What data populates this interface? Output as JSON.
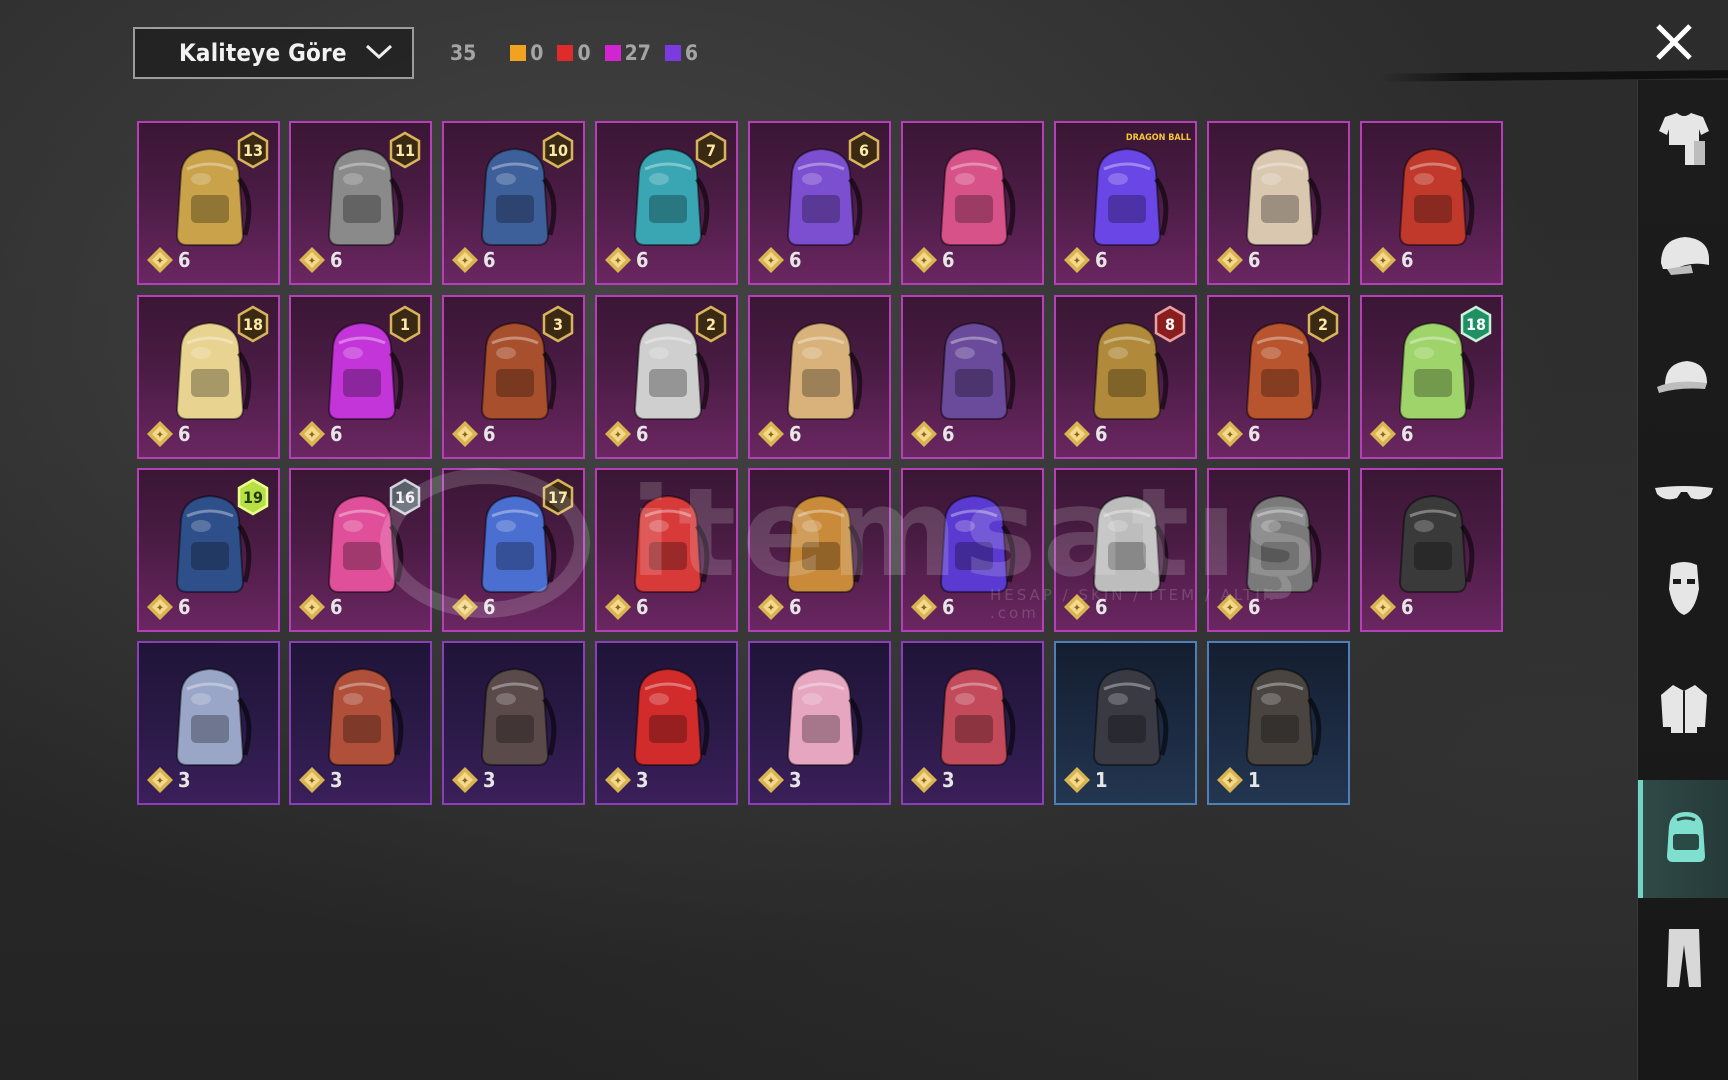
{
  "toolbar": {
    "sort_label": "Kaliteye Göre",
    "sort_icon": "chevron-down-icon",
    "total_count": "35",
    "quality_counts": [
      {
        "color": "#f1a220",
        "count": "0"
      },
      {
        "color": "#e02b2b",
        "count": "0"
      },
      {
        "color": "#d025d0",
        "count": "27"
      },
      {
        "color": "#7b3be0",
        "count": "6"
      }
    ],
    "close_icon": "close-icon"
  },
  "sidebar": {
    "items": [
      {
        "icon": "outfit-icon",
        "active": false
      },
      {
        "icon": "helmet-icon",
        "active": false
      },
      {
        "icon": "cap-icon",
        "active": false
      },
      {
        "icon": "sunglasses-icon",
        "active": false
      },
      {
        "icon": "mask-icon",
        "active": false
      },
      {
        "icon": "jacket-icon",
        "active": false
      },
      {
        "icon": "backpack-icon",
        "active": true
      },
      {
        "icon": "pants-icon",
        "active": false
      }
    ]
  },
  "items": [
    {
      "value": "6",
      "badge": "13",
      "tier": "legend",
      "art": "#c9a24a"
    },
    {
      "value": "6",
      "badge": "11",
      "tier": "legend",
      "art": "#8a8a8a"
    },
    {
      "value": "6",
      "badge": "10",
      "tier": "legend",
      "art": "#3d5f9a"
    },
    {
      "value": "6",
      "badge": "7",
      "tier": "legend",
      "art": "#3aa6b3"
    },
    {
      "value": "6",
      "badge": "6",
      "tier": "legend",
      "art": "#7c4ed0"
    },
    {
      "value": "6",
      "badge": "",
      "tier": "legend",
      "art": "#d8528a"
    },
    {
      "value": "6",
      "badge": "",
      "tier": "legend",
      "art": "#6a46e6",
      "logo": "DRAGON BALL"
    },
    {
      "value": "6",
      "badge": "",
      "tier": "legend",
      "art": "#d9c7b0"
    },
    {
      "value": "6",
      "badge": "",
      "tier": "legend",
      "art": "#c0392b"
    },
    {
      "value": "6",
      "badge": "18",
      "tier": "legend",
      "art": "#e8d390"
    },
    {
      "value": "6",
      "badge": "1",
      "tier": "legend",
      "art": "#c335d9"
    },
    {
      "value": "6",
      "badge": "3",
      "tier": "legend",
      "art": "#a8502e"
    },
    {
      "value": "6",
      "badge": "2",
      "tier": "legend",
      "art": "#cfcfcf"
    },
    {
      "value": "6",
      "badge": "",
      "tier": "legend",
      "art": "#d8b27a"
    },
    {
      "value": "6",
      "badge": "",
      "tier": "legend",
      "art": "#6a4a9a"
    },
    {
      "value": "6",
      "badge": "8",
      "tier": "legend",
      "art": "#b08a3a",
      "badge_style": "red"
    },
    {
      "value": "6",
      "badge": "2",
      "tier": "legend",
      "art": "#b8552e"
    },
    {
      "value": "6",
      "badge": "18",
      "tier": "legend",
      "art": "#9fd46a",
      "badge_style": "teal"
    },
    {
      "value": "6",
      "badge": "19",
      "tier": "legend",
      "art": "#2e4f8a",
      "badge_style": "green"
    },
    {
      "value": "6",
      "badge": "16",
      "tier": "legend",
      "art": "#e04f9a",
      "badge_style": "silver"
    },
    {
      "value": "6",
      "badge": "17",
      "tier": "legend",
      "art": "#4a6fd0"
    },
    {
      "value": "6",
      "badge": "",
      "tier": "legend",
      "art": "#d83a3a"
    },
    {
      "value": "6",
      "badge": "",
      "tier": "legend",
      "art": "#c98a3a"
    },
    {
      "value": "6",
      "badge": "",
      "tier": "legend",
      "art": "#5a3ad0"
    },
    {
      "value": "6",
      "badge": "",
      "tier": "legend",
      "art": "#bdbdbd"
    },
    {
      "value": "6",
      "badge": "",
      "tier": "legend",
      "art": "#7a7a7a"
    },
    {
      "value": "6",
      "badge": "",
      "tier": "legend",
      "art": "#3a3a3a"
    },
    {
      "value": "3",
      "badge": "",
      "tier": "epic",
      "art": "#9aa6c8"
    },
    {
      "value": "3",
      "badge": "",
      "tier": "epic",
      "art": "#b0503a"
    },
    {
      "value": "3",
      "badge": "",
      "tier": "epic",
      "art": "#5a4a4a"
    },
    {
      "value": "3",
      "badge": "",
      "tier": "epic",
      "art": "#d22b2b"
    },
    {
      "value": "3",
      "badge": "",
      "tier": "epic",
      "art": "#e6a6c0"
    },
    {
      "value": "3",
      "badge": "",
      "tier": "epic",
      "art": "#c24a5a"
    },
    {
      "value": "1",
      "badge": "",
      "tier": "rare",
      "art": "#3a3a44"
    },
    {
      "value": "1",
      "badge": "",
      "tier": "rare",
      "art": "#4a4440"
    }
  ]
}
